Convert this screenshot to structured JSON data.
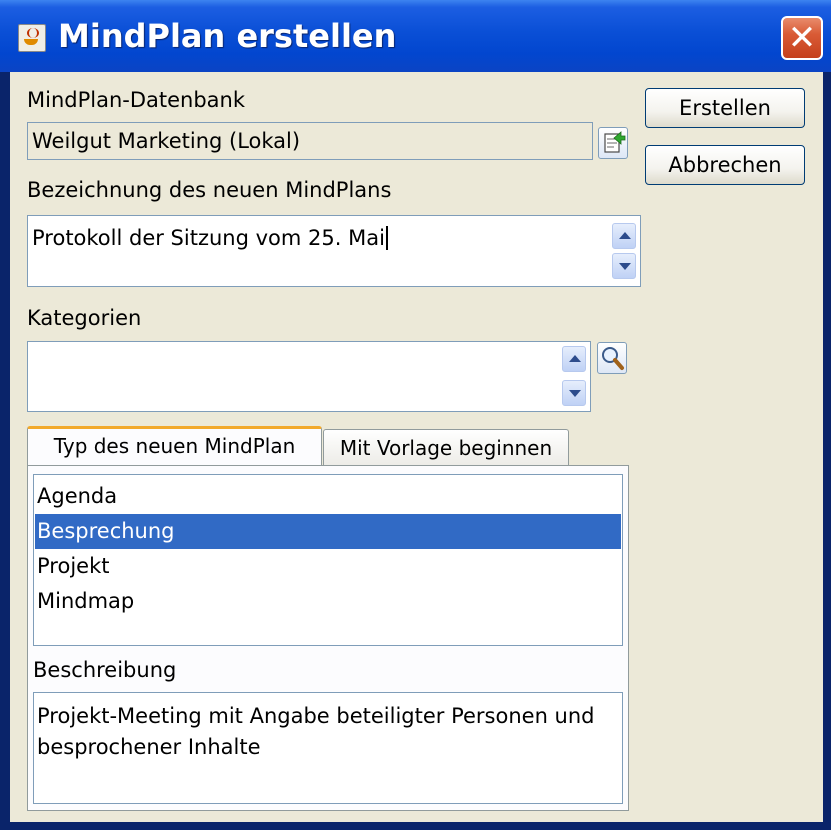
{
  "window": {
    "title": "MindPlan erstellen",
    "close_label": "✕"
  },
  "database": {
    "label": "MindPlan-Datenbank",
    "value": "Weilgut Marketing (Lokal)"
  },
  "name_field": {
    "label": "Bezeichnung des neuen MindPlans",
    "value": "Protokoll der Sitzung vom 25. Mai"
  },
  "categories": {
    "label": "Kategorien",
    "value": ""
  },
  "buttons": {
    "create": "Erstellen",
    "cancel": "Abbrechen"
  },
  "tabs": [
    {
      "label": "Typ des neuen MindPlan",
      "active": true
    },
    {
      "label": "Mit Vorlage beginnen",
      "active": false
    }
  ],
  "type_list": {
    "items": [
      "Agenda",
      "Besprechung",
      "Projekt",
      "Mindmap"
    ],
    "selected": "Besprechung"
  },
  "description": {
    "label": "Beschreibung",
    "text": "Projekt-Meeting mit Angabe beteiligter Personen und besprochener Inhalte"
  },
  "colors": {
    "titlebar": "#0a4fd6",
    "selection": "#316ac5",
    "dialog_bg": "#ece9d8",
    "close": "#d95b36"
  }
}
